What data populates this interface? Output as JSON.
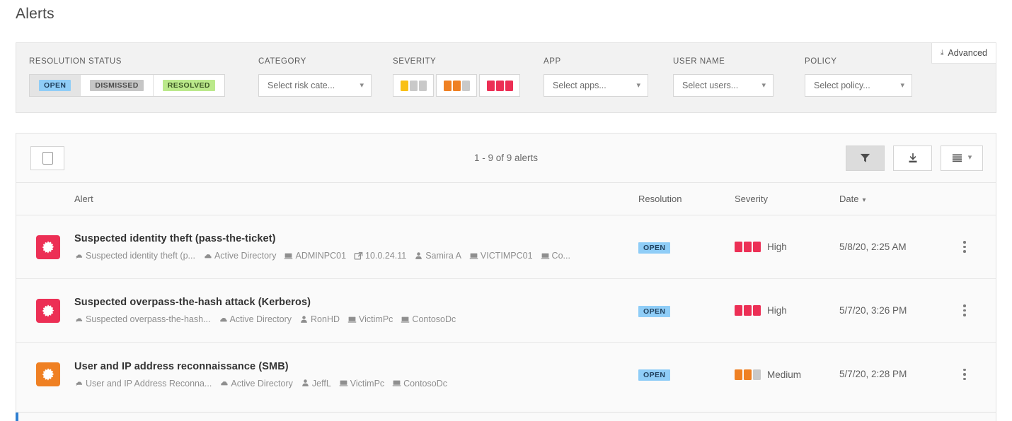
{
  "page_title": "Alerts",
  "filters": {
    "resolution_status": {
      "label": "RESOLUTION STATUS",
      "options": [
        {
          "label": "OPEN",
          "selected": true
        },
        {
          "label": "DISMISSED",
          "selected": false
        },
        {
          "label": "RESOLVED",
          "selected": false
        }
      ]
    },
    "category": {
      "label": "CATEGORY",
      "placeholder": "Select risk cate..."
    },
    "severity": {
      "label": "SEVERITY",
      "levels": [
        {
          "name": "low",
          "filled": 1
        },
        {
          "name": "medium",
          "filled": 2
        },
        {
          "name": "high",
          "filled": 3
        }
      ]
    },
    "app": {
      "label": "APP",
      "placeholder": "Select apps..."
    },
    "user_name": {
      "label": "USER NAME",
      "placeholder": "Select users..."
    },
    "policy": {
      "label": "POLICY",
      "placeholder": "Select policy..."
    },
    "advanced_label": "Advanced"
  },
  "toolbar": {
    "count_text": "1 - 9 of 9 alerts",
    "filter_button_label": "",
    "export_button_label": "",
    "view_button_label": ""
  },
  "table": {
    "headers": {
      "alert": "Alert",
      "resolution": "Resolution",
      "severity": "Severity",
      "date": "Date"
    },
    "rows": [
      {
        "title": "Suspected identity theft (pass-the-ticket)",
        "icon_color": "#ec2f55",
        "meta": [
          {
            "icon": "policy-icon",
            "text": "Suspected identity theft (p..."
          },
          {
            "icon": "cloud-icon",
            "text": "Active Directory"
          },
          {
            "icon": "computer-icon",
            "text": "ADMINPC01"
          },
          {
            "icon": "external-link-icon",
            "text": "10.0.24.11"
          },
          {
            "icon": "user-icon",
            "text": "Samira A"
          },
          {
            "icon": "computer-icon",
            "text": "VICTIMPC01"
          },
          {
            "icon": "computer-icon",
            "text": "Co..."
          }
        ],
        "resolution": "OPEN",
        "severity_label": "High",
        "severity_filled": 3,
        "severity_color": "#ec2f55",
        "date": "5/8/20, 2:25 AM"
      },
      {
        "title": "Suspected overpass-the-hash attack (Kerberos)",
        "icon_color": "#ec2f55",
        "meta": [
          {
            "icon": "policy-icon",
            "text": "Suspected overpass-the-hash..."
          },
          {
            "icon": "cloud-icon",
            "text": "Active Directory"
          },
          {
            "icon": "user-icon",
            "text": "RonHD"
          },
          {
            "icon": "computer-icon",
            "text": "VictimPc"
          },
          {
            "icon": "computer-icon",
            "text": "ContosoDc"
          }
        ],
        "resolution": "OPEN",
        "severity_label": "High",
        "severity_filled": 3,
        "severity_color": "#ec2f55",
        "date": "5/7/20, 3:26 PM"
      },
      {
        "title": "User and IP address reconnaissance (SMB)",
        "icon_color": "#ef8023",
        "meta": [
          {
            "icon": "policy-icon",
            "text": "User and IP Address Reconna..."
          },
          {
            "icon": "cloud-icon",
            "text": "Active Directory"
          },
          {
            "icon": "user-icon",
            "text": "JeffL"
          },
          {
            "icon": "computer-icon",
            "text": "VictimPc"
          },
          {
            "icon": "computer-icon",
            "text": "ContosoDc"
          }
        ],
        "resolution": "OPEN",
        "severity_label": "Medium",
        "severity_filled": 2,
        "severity_color": "#ef8023",
        "date": "5/7/20, 2:28 PM"
      }
    ]
  },
  "colors": {
    "low": "#f9c016",
    "medium": "#ef8023",
    "high": "#ec2f55",
    "empty": "#c9c9c9",
    "chip_open": "#8fcdf7",
    "chip_dismissed": "#c6c6c6",
    "chip_resolved": "#bbe98b",
    "accent": "#2f7fd1"
  }
}
